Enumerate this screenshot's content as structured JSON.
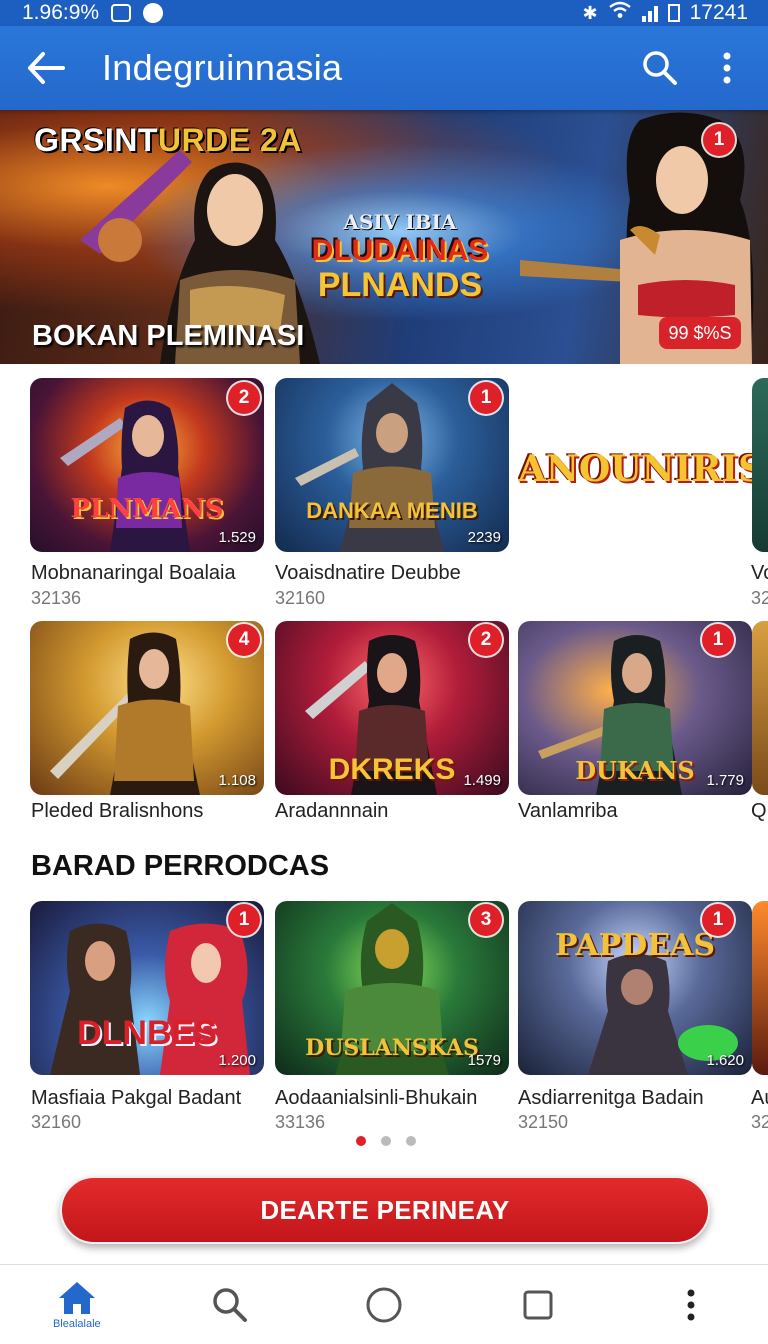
{
  "status_bar": {
    "left_text": "1.96:9%",
    "right_text": "17241"
  },
  "app_bar": {
    "title": "Indegruinnasia"
  },
  "hero": {
    "title_white": "GRSINT",
    "title_gold": "URDE 2A",
    "logo_line1": "ASIV IBIA",
    "logo_line2": "DLUDAINAS",
    "logo_line3": "PLNANDS",
    "subtitle": "BOKAN PLEMINASI",
    "price": "99 $%S",
    "badge": "1"
  },
  "rows": [
    {
      "cards": [
        {
          "badge": "2",
          "thumb_title": "PLNMANS",
          "count": "1.529",
          "name": "Mobnanaringal Boalaia",
          "sub": "32136"
        },
        {
          "badge": "1",
          "thumb_title": "DANKAA MENIB",
          "count": "2239",
          "name": "Voaisdnatire Deubbe",
          "sub": "32160"
        },
        {
          "badge": "",
          "thumb_title": "ANOUNIRIS",
          "count": "",
          "name": "",
          "sub": ""
        }
      ],
      "peek_name": "Vo",
      "peek_sub": "32"
    },
    {
      "cards": [
        {
          "badge": "4",
          "thumb_title": "",
          "count": "1.108",
          "name": "Pleded Bralisnhons",
          "sub": ""
        },
        {
          "badge": "2",
          "thumb_title": "DKREKS",
          "count": "1.499",
          "name": "Aradannnain",
          "sub": ""
        },
        {
          "badge": "1",
          "thumb_title": "DUKANS",
          "count": "1.779",
          "name": "Vanlamriba",
          "sub": ""
        }
      ],
      "peek_name": "Q"
    }
  ],
  "section": {
    "title": "BARAD PERRODCAS",
    "cards": [
      {
        "badge": "1",
        "thumb_title": "DLNBES",
        "count": "1.200",
        "name": "Masfiaia Pakgal Badant",
        "sub": "32160"
      },
      {
        "badge": "3",
        "thumb_title": "DUSLANSKAS",
        "count": "1579",
        "name": "Aodaanialsinli-Bhukain",
        "sub": "33136"
      },
      {
        "badge": "1",
        "thumb_title": "PAPDEAS",
        "count": "1.620",
        "name": "Asdiarrenitga Badain",
        "sub": "32150"
      }
    ],
    "peek_name": "Au",
    "peek_sub": "32"
  },
  "cta_label": "DEARTE PERINEAY",
  "bottom_nav": {
    "home_label": "Blealalale"
  },
  "colors": {
    "primary": "#2468cc",
    "accent_red": "#e02028"
  }
}
